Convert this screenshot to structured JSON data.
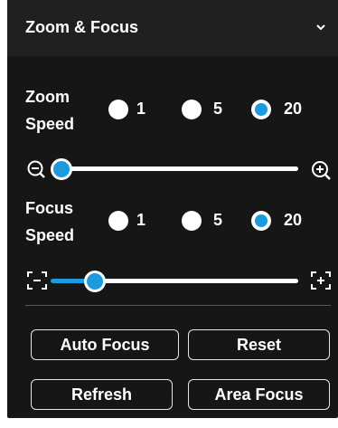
{
  "panel": {
    "title": "Zoom & Focus",
    "collapse_icon": "chevron-down-icon"
  },
  "zoom": {
    "label_line1": "Zoom",
    "label_line2": "Speed",
    "options": [
      "1",
      "5",
      "20"
    ],
    "selected": "20",
    "slider_value_fraction": 0.0,
    "min_icon": "zoom-out-icon",
    "max_icon": "zoom-in-icon"
  },
  "focus": {
    "label_line1": "Focus",
    "label_line2": "Speed",
    "options": [
      "1",
      "5",
      "20"
    ],
    "selected": "20",
    "slider_value_fraction": 0.18,
    "min_icon": "focus-near-icon",
    "max_icon": "focus-far-icon"
  },
  "buttons": {
    "auto_focus": "Auto Focus",
    "reset": "Reset",
    "refresh": "Refresh",
    "area_focus": "Area Focus"
  },
  "colors": {
    "accent": "#1a9be0",
    "panel_bg": "#161616",
    "header_bg": "#202020"
  }
}
